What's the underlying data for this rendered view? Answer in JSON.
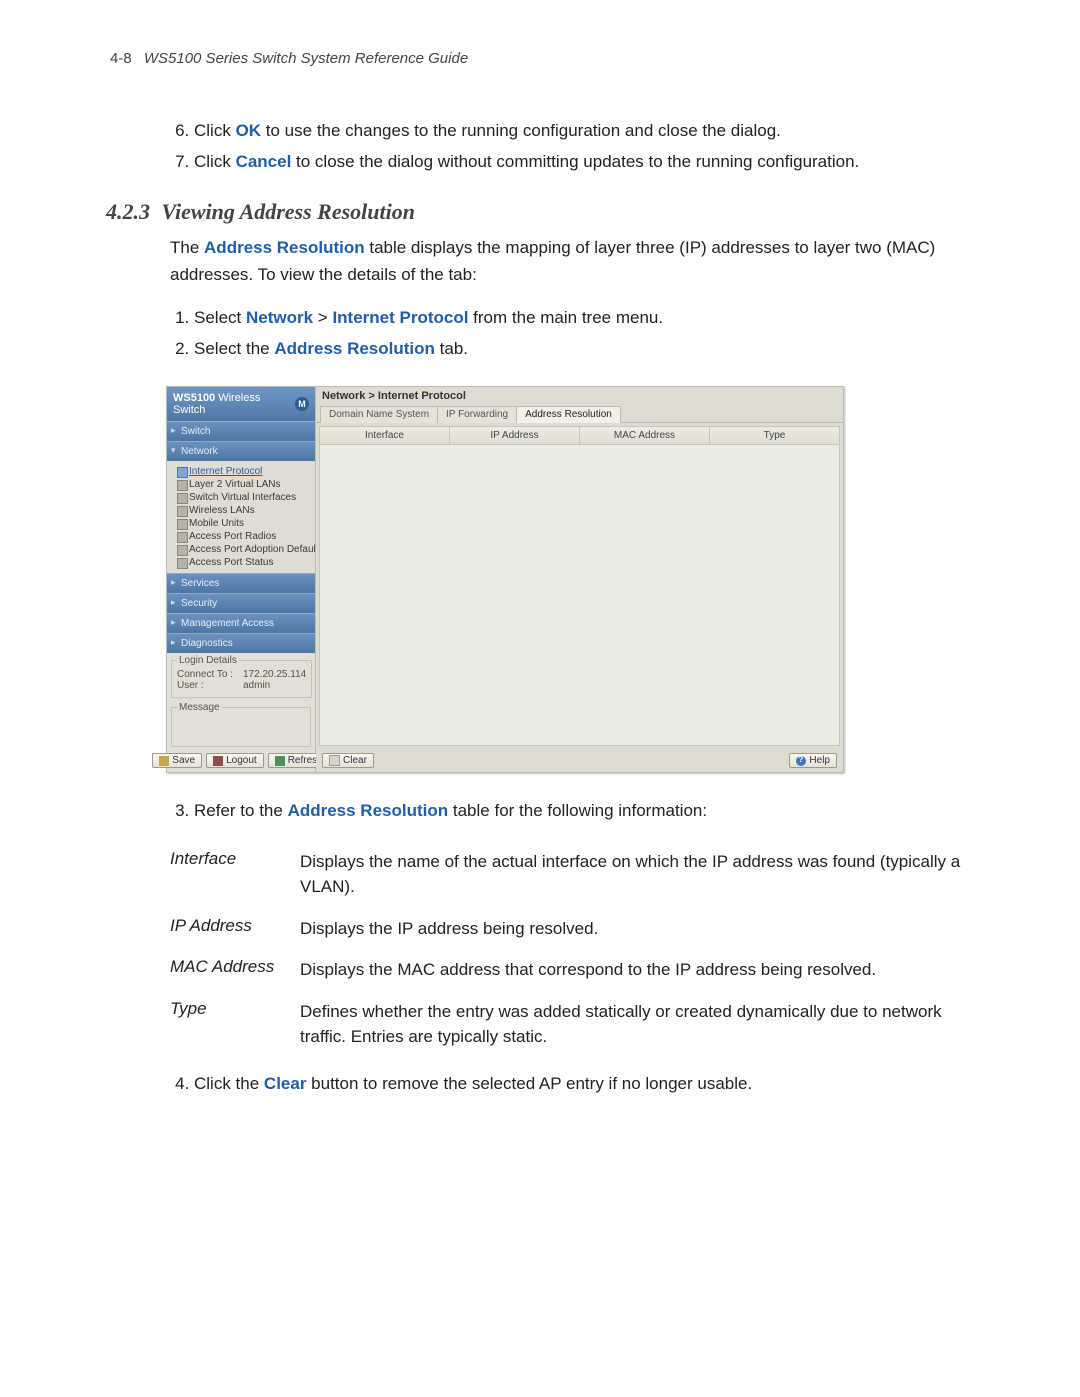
{
  "page_header": {
    "page_num": "4-8",
    "title": "WS5100 Series Switch System Reference Guide"
  },
  "pre_steps": [
    {
      "num": "6.",
      "prefix": "Click ",
      "kw": "OK",
      "suffix": " to use the changes to the running configuration and close the dialog."
    },
    {
      "num": "7.",
      "prefix": "Click ",
      "kw": "Cancel",
      "suffix": " to close the dialog without committing updates to the running configuration."
    }
  ],
  "section": {
    "num": "4.2.3",
    "title": "Viewing Address Resolution"
  },
  "intro": {
    "prefix": "The ",
    "kw": "Address Resolution",
    "suffix": " table displays the mapping of layer three (IP) addresses to layer two (MAC) addresses. To view the details of the tab:"
  },
  "steps_before_shot": [
    {
      "num": "1.",
      "parts": [
        "Select ",
        "Network",
        " > ",
        "Internet Protocol",
        " from the main tree menu."
      ]
    },
    {
      "num": "2.",
      "parts": [
        "Select the ",
        "Address Resolution",
        " tab."
      ]
    }
  ],
  "screenshot": {
    "app": {
      "brand": "WS5100",
      "rest": "Wireless Switch"
    },
    "nav_categories": [
      "Switch",
      "Network",
      "Services",
      "Security",
      "Management Access",
      "Diagnostics"
    ],
    "nav_open": "Network",
    "tree_items": [
      {
        "label": "Internet Protocol",
        "selected": true
      },
      {
        "label": "Layer 2 Virtual LANs",
        "selected": false
      },
      {
        "label": "Switch Virtual Interfaces",
        "selected": false
      },
      {
        "label": "Wireless LANs",
        "selected": false
      },
      {
        "label": "Mobile Units",
        "selected": false
      },
      {
        "label": "Access Port Radios",
        "selected": false
      },
      {
        "label": "Access Port Adoption Defaults",
        "selected": false
      },
      {
        "label": "Access Port Status",
        "selected": false
      }
    ],
    "login": {
      "legend": "Login Details",
      "connect_label": "Connect To :",
      "connect_value": "172.20.25.114",
      "user_label": "User :",
      "user_value": "admin"
    },
    "message": {
      "legend": "Message"
    },
    "sidebar_buttons": {
      "save": "Save",
      "logout": "Logout",
      "refresh": "Refresh"
    },
    "breadcrumb": "Network > Internet Protocol",
    "tabs": [
      {
        "label": "Domain Name System",
        "active": false
      },
      {
        "label": "IP Forwarding",
        "active": false
      },
      {
        "label": "Address Resolution",
        "active": true
      }
    ],
    "columns": [
      "Interface",
      "IP Address",
      "MAC Address",
      "Type"
    ],
    "bottom_buttons": {
      "clear": "Clear",
      "help": "Help"
    }
  },
  "step3": {
    "num": "3.",
    "prefix": "Refer to the ",
    "kw": "Address Resolution",
    "suffix": " table for the following information:"
  },
  "info_rows": [
    {
      "term": "Interface",
      "def": "Displays the name of the actual interface on which the IP address was found (typically a VLAN)."
    },
    {
      "term": "IP Address",
      "def": "Displays the IP address being resolved."
    },
    {
      "term": "MAC Address",
      "def": "Displays the MAC address that correspond to the IP address being resolved."
    },
    {
      "term": "Type",
      "def": "Defines whether the entry was added statically or created dynamically due to network traffic. Entries are typically static."
    }
  ],
  "step4": {
    "num": "4.",
    "prefix": "Click the ",
    "kw": "Clear",
    "suffix": " button to remove the selected AP entry if no longer usable."
  }
}
